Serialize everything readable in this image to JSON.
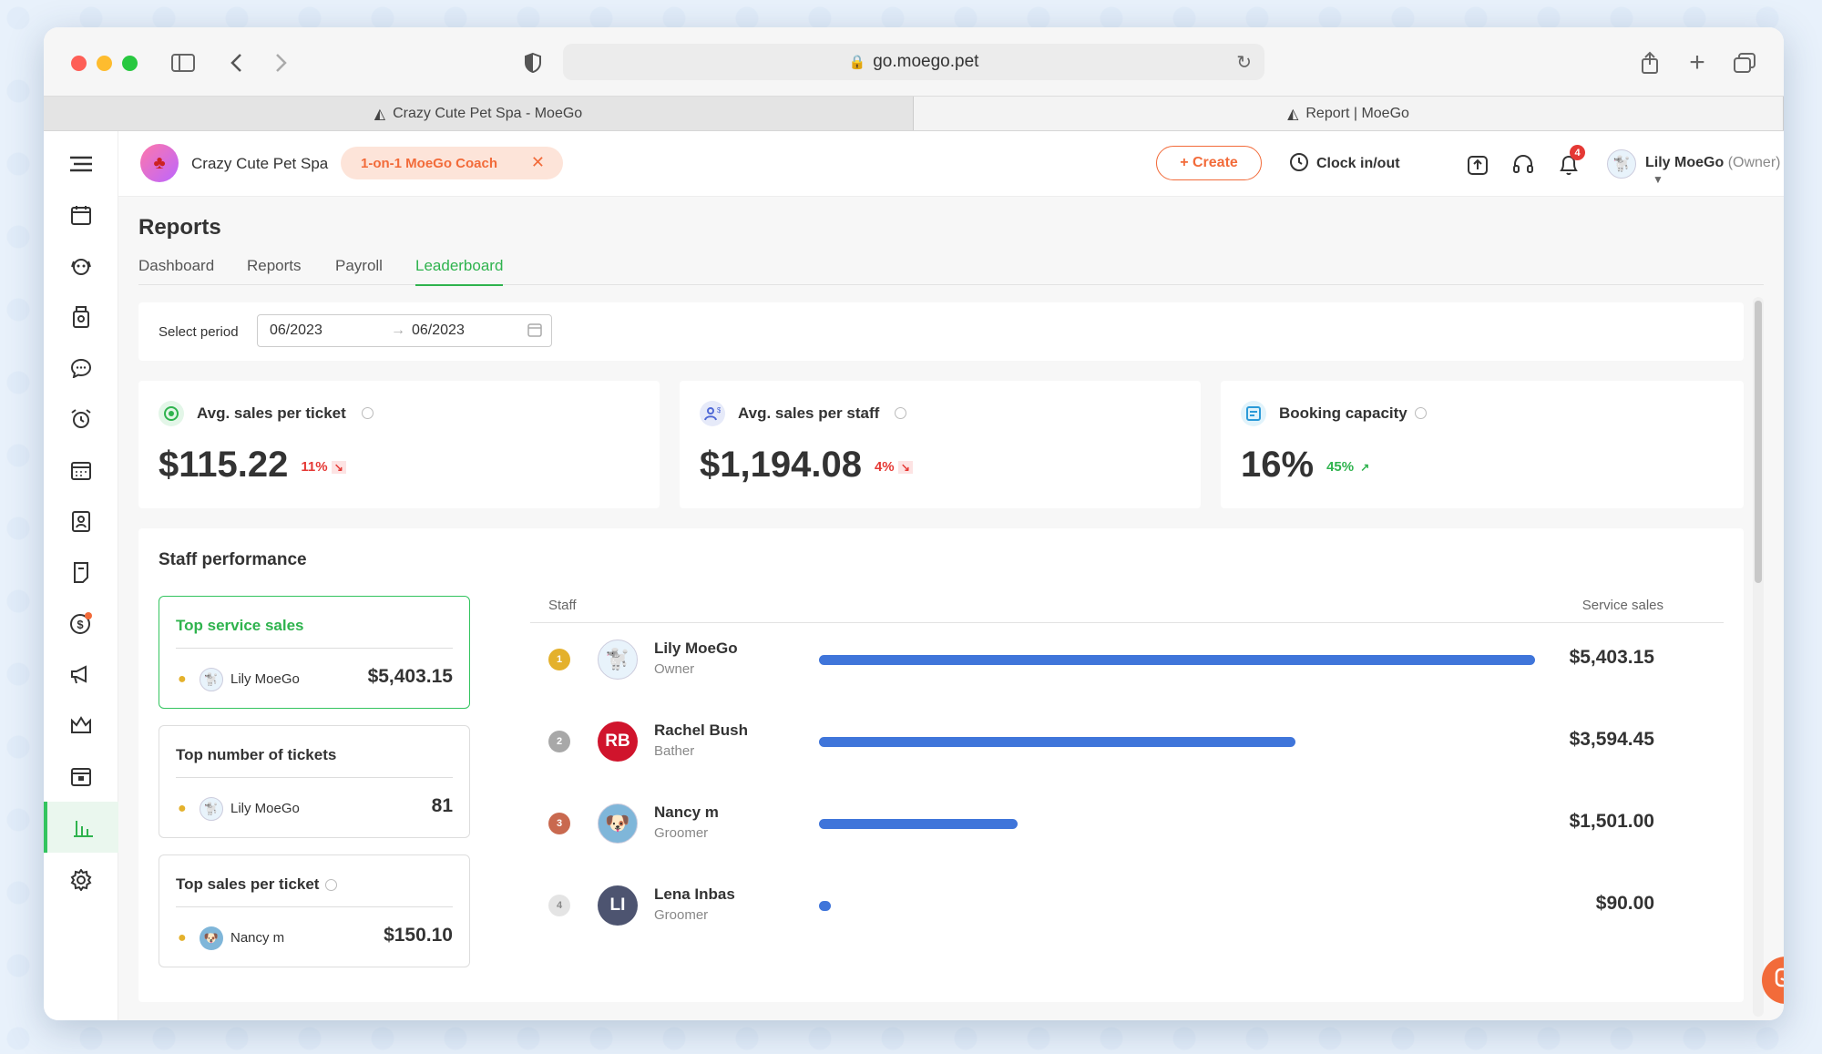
{
  "browser": {
    "url": "go.moego.pet",
    "tabs": [
      {
        "label": "Crazy Cute Pet Spa - MoeGo"
      },
      {
        "label": "Report | MoeGo"
      }
    ]
  },
  "topbar": {
    "business_name": "Crazy Cute Pet Spa",
    "coach_chip": "1-on-1 MoeGo Coach",
    "create_label": "+ Create",
    "clock_label": "Clock in/out",
    "notification_count": "4",
    "user_name": "Lily MoeGo",
    "user_role": "(Owner)"
  },
  "page": {
    "title": "Reports",
    "tabs": [
      "Dashboard",
      "Reports",
      "Payroll",
      "Leaderboard"
    ],
    "active_tab": "Leaderboard"
  },
  "period": {
    "label": "Select period",
    "start": "06/2023",
    "end": "06/2023"
  },
  "kpis": [
    {
      "title": "Avg. sales per ticket",
      "value": "$115.22",
      "change": "11%",
      "direction": "down",
      "color": "#e53935"
    },
    {
      "title": "Avg. sales per staff",
      "value": "$1,194.08",
      "change": "4%",
      "direction": "down",
      "color": "#e53935"
    },
    {
      "title": "Booking capacity",
      "value": "16%",
      "change": "45%",
      "direction": "up",
      "color": "#2fb34e"
    }
  ],
  "staff_performance": {
    "title": "Staff performance",
    "cards": [
      {
        "title": "Top service sales",
        "name": "Lily MoeGo",
        "value": "$5,403.15"
      },
      {
        "title": "Top number of tickets",
        "name": "Lily MoeGo",
        "value": "81"
      },
      {
        "title": "Top sales per ticket",
        "name": "Nancy m",
        "value": "$150.10"
      }
    ],
    "table": {
      "col_staff": "Staff",
      "col_sales": "Service sales",
      "max_value": 5403.15,
      "rows": [
        {
          "rank": "1",
          "name": "Lily MoeGo",
          "role": "Owner",
          "value": "$5,403.15",
          "amount": 5403.15,
          "initials": ""
        },
        {
          "rank": "2",
          "name": "Rachel Bush",
          "role": "Bather",
          "value": "$3,594.45",
          "amount": 3594.45,
          "initials": "RB"
        },
        {
          "rank": "3",
          "name": "Nancy m",
          "role": "Groomer",
          "value": "$1,501.00",
          "amount": 1501.0,
          "initials": ""
        },
        {
          "rank": "4",
          "name": "Lena Inbas",
          "role": "Groomer",
          "value": "$90.00",
          "amount": 90.0,
          "initials": "LI"
        }
      ]
    }
  },
  "colors": {
    "accent": "#33c45f",
    "brand_orange": "#f26b3a",
    "bar": "#3f75da"
  }
}
